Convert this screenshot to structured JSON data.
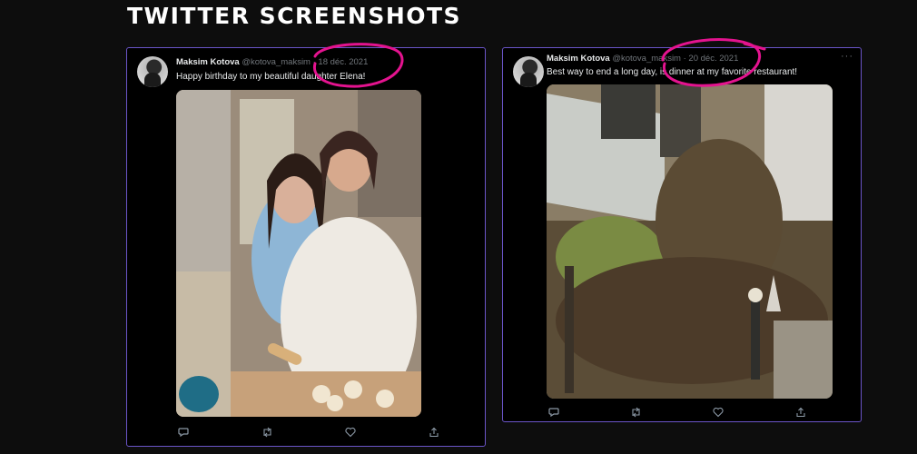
{
  "page": {
    "title": "TWITTER SCREENSHOTS"
  },
  "tweets": [
    {
      "author": "Maksim Kotova",
      "handle": "@kotova_maksim",
      "date": "18 déc. 2021",
      "separator": "·",
      "text": "Happy birthday to my beautiful daughter Elena!",
      "media_desc": "photo-mother-daughter-kitchen"
    },
    {
      "author": "Maksim Kotova",
      "handle": "@kotova_maksim",
      "date": "20 déc. 2021",
      "separator": "·",
      "text": "Best way to end a long day, is dinner at my favorite restaurant!",
      "more": "···",
      "media_desc": "photo-restaurant-facade-vines"
    }
  ],
  "actions": [
    "reply-icon",
    "retweet-icon",
    "like-icon",
    "share-icon"
  ],
  "colors": {
    "card_border": "#6b55c9",
    "highlight": "#e4138f"
  }
}
